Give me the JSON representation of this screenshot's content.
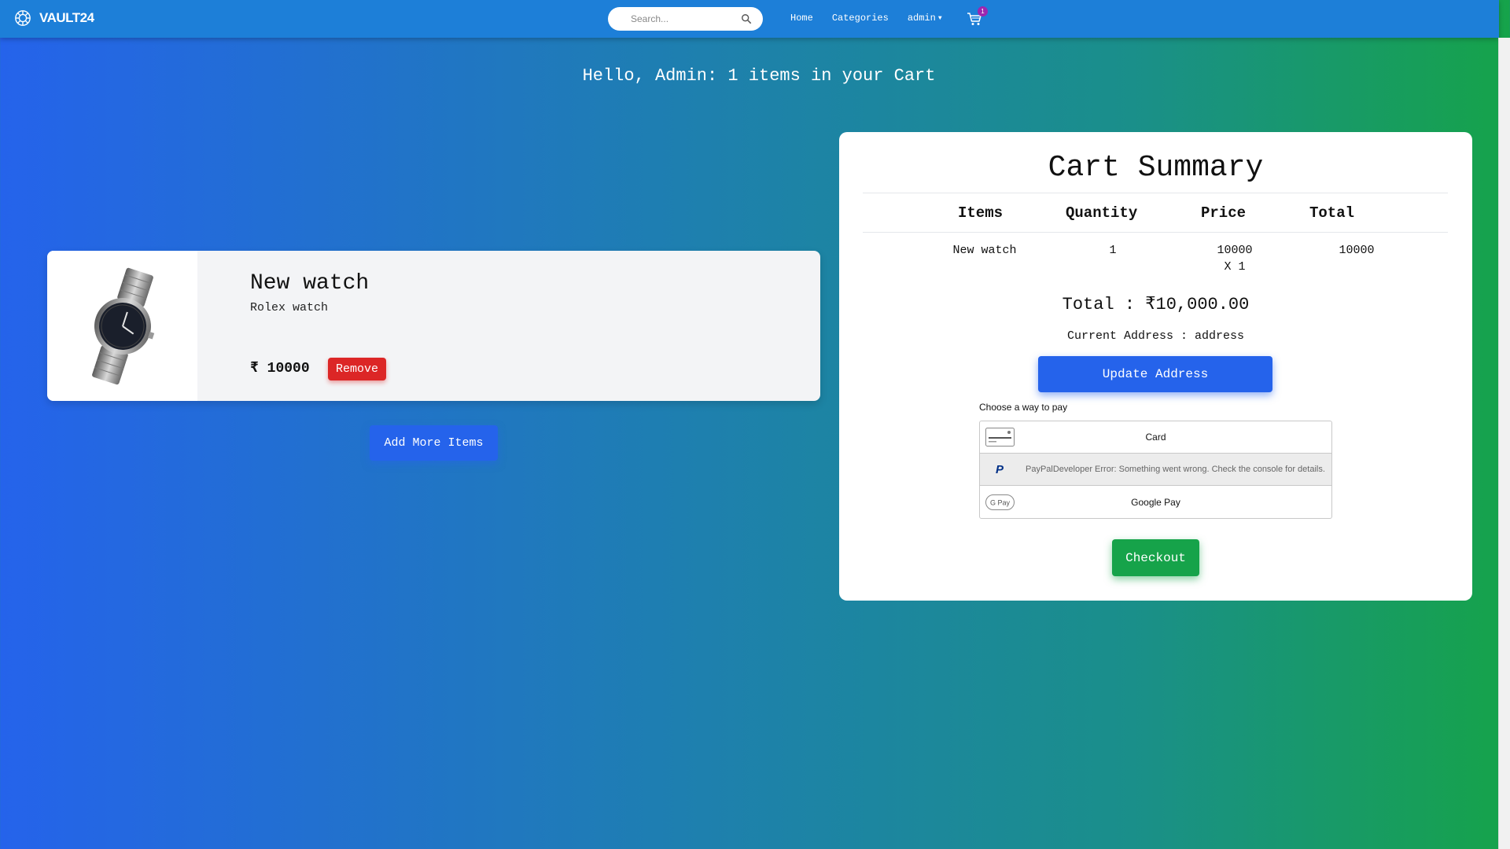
{
  "navbar": {
    "brand": "VAULT24",
    "search_placeholder": "Search...",
    "links": [
      "Home",
      "Categories",
      "admin"
    ],
    "cart_count": "1"
  },
  "greeting": "Hello, Admin: 1 items in your Cart",
  "cart_item": {
    "name": "New watch",
    "description": "Rolex watch",
    "price": "₹ 10000",
    "remove_label": "Remove"
  },
  "add_more_label": "Add More Items",
  "summary": {
    "title": "Cart Summary",
    "headers": [
      "Items",
      "Quantity",
      "Price",
      "Total"
    ],
    "row": {
      "item": "New watch",
      "quantity": "1",
      "price_line1": "10000",
      "price_line2": "X 1",
      "total": "10000"
    },
    "grand_total": "Total : ₹10,000.00",
    "address": "Current Address : address",
    "update_address_label": "Update Address",
    "pay_label": "Choose a way to pay",
    "pay_options": {
      "card": "Card",
      "paypal": "PayPalDeveloper Error: Something went wrong. Check the console for details.",
      "gpay": "Google Pay"
    },
    "checkout_label": "Checkout"
  },
  "colors": {
    "navbar": "#1d7fd8",
    "primary": "#2563eb",
    "danger": "#dc2626",
    "success": "#16a34a",
    "badge": "#9c27b0"
  }
}
